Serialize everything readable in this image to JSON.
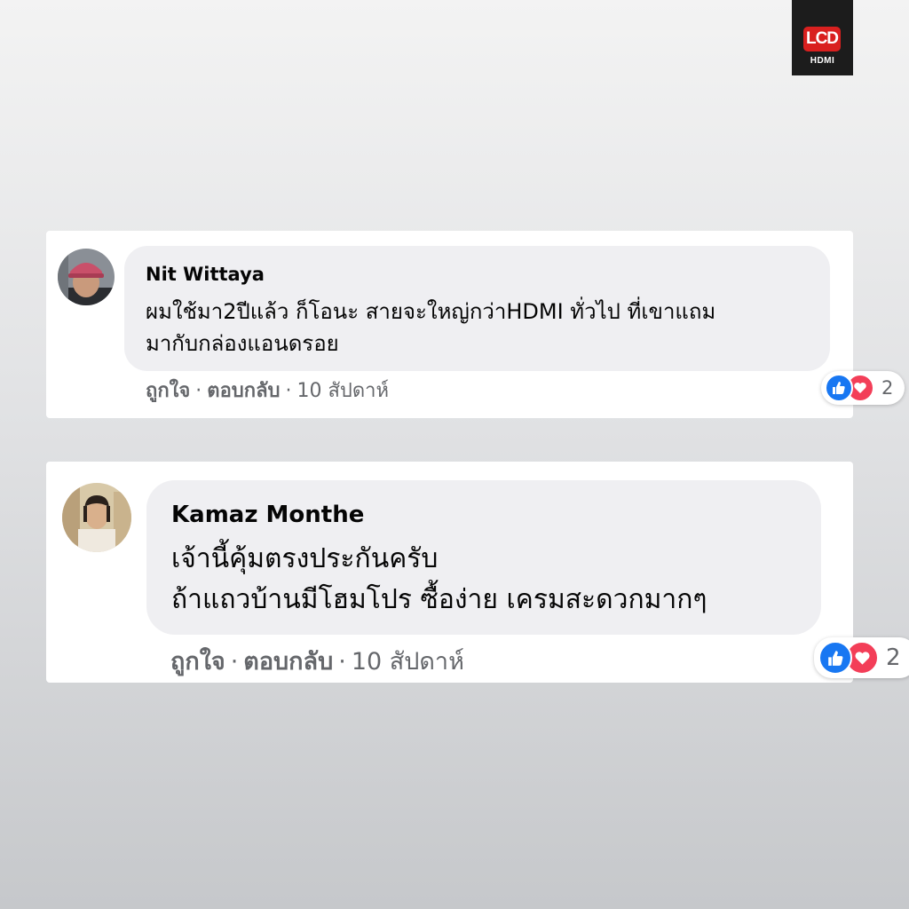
{
  "logo": {
    "text": "LCD",
    "subtext": "HDMI"
  },
  "comments": [
    {
      "author": "Nit Wittaya",
      "lines": [
        "ผมใช้มา2ปีแล้ว ก็โอนะ สายจะใหญ่กว่าHDMI ทั่วไป ที่เขาแถม",
        "มากับกล่องแอนดรอย"
      ],
      "like_label": "ถูกใจ",
      "reply_label": "ตอบกลับ",
      "separator": "·",
      "time": "10 สัปดาห์",
      "reaction_count": "2",
      "reactions": [
        "like-icon",
        "love-icon"
      ]
    },
    {
      "author": "Kamaz Monthe",
      "lines": [
        "เจ้านี้คุ้มตรงประกันครับ",
        "ถ้าแถวบ้านมีโฮมโปร ซื้อง่าย เครมสะดวกมากๆ"
      ],
      "like_label": "ถูกใจ",
      "reply_label": "ตอบกลับ",
      "separator": "·",
      "time": "10 สัปดาห์",
      "reaction_count": "2",
      "reactions": [
        "like-icon",
        "love-icon"
      ]
    }
  ],
  "colors": {
    "like_blue": "#1877f2",
    "love_red": "#f33e58",
    "logo_red": "#d9201f",
    "meta_gray": "#65676b"
  }
}
